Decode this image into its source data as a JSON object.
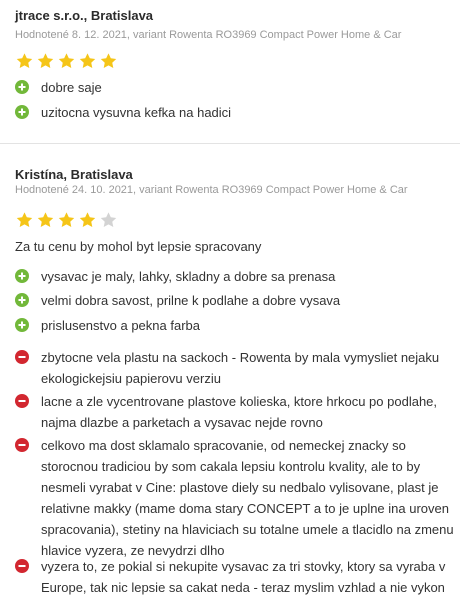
{
  "reviews": [
    {
      "author": "jtrace s.r.o., Bratislava",
      "meta": "Hodnotené 8. 12. 2021, variant Rowenta RO3969 Compact Power Home & Car",
      "rating": 5,
      "summary": "",
      "pros": [
        "dobre saje",
        "uzitocna vysuvna kefka na hadici"
      ],
      "cons": []
    },
    {
      "author": "Kristína, Bratislava",
      "meta": "Hodnotené 24. 10. 2021, variant Rowenta RO3969 Compact Power Home & Car",
      "rating": 4,
      "summary": "Za tu cenu by mohol byt lepsie spracovany",
      "pros": [
        "vysavac je maly, lahky, skladny a dobre sa prenasa",
        "velmi dobra savost, prilne k podlahe a dobre vysava",
        "prislusenstvo a pekna farba"
      ],
      "cons": [
        "zbytocne vela plastu na sackoch - Rowenta by mala vymysliet nejaku ekologickejsiu papierovu verziu",
        "lacne a zle vycentrovane plastove kolieska, ktore hrkocu po podlahe, najma dlazbe a parketach a vysavac nejde rovno",
        "celkovo ma dost sklamalo spracovanie, od nemeckej znacky so storocnou tradiciou by som cakala lepsiu kontrolu kvality, ale to by nesmeli vyrabat v Cine: plastove diely su nedbalo vylisovane, plast je relativne makky (mame doma stary CONCEPT a to je uplne ina uroven spracovania), stetiny na hlaviciach su totalne umele a tlacidlo na zmenu hlavice vyzera, ze nevydrzi dlho",
        "vyzera to, ze pokial si nekupite vysavac za tri stovky, ktory sa vyraba v Europe, tak nic lepsie sa cakat neda - teraz myslim vzhlad a nie vykon"
      ]
    }
  ],
  "colors": {
    "star_filled": "#f5c518",
    "star_empty": "#d3d3d3",
    "pro_icon": "#72b83a",
    "con_icon": "#d22730",
    "meta_text": "#9a9a9a",
    "divider": "#e3e3e3"
  },
  "icons": {
    "pro": "plus-circle-icon",
    "con": "minus-circle-icon",
    "rating": "star-icon"
  }
}
